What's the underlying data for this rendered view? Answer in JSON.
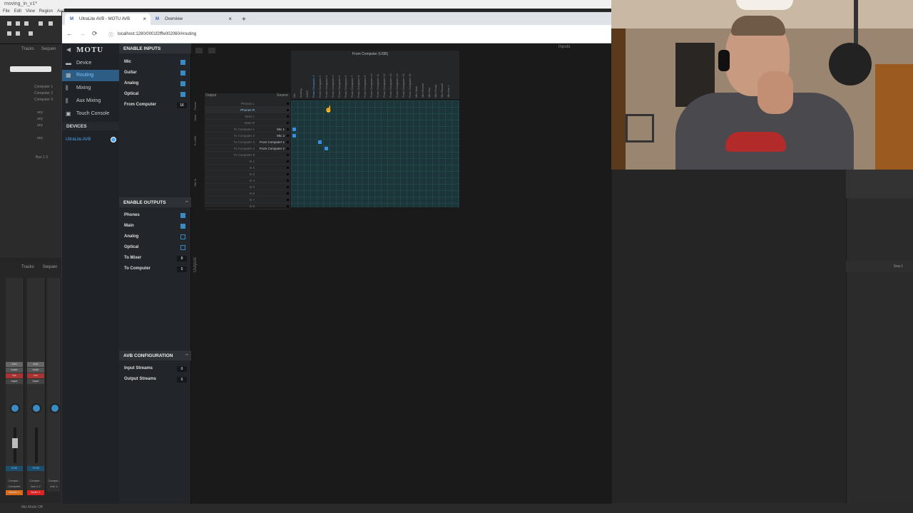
{
  "daw": {
    "title": "moving_in_v1*",
    "menu": [
      "File",
      "Edit",
      "View",
      "Region",
      "Aud"
    ],
    "tabs_top": [
      "Tracks",
      "Sequen"
    ],
    "tabs_bottom": [
      "Tracks",
      "Sequen"
    ],
    "track_list": [
      "Computer 1",
      "Computer 2",
      "Computer 3",
      "any",
      "any",
      "any",
      "any",
      "Bus 1-2"
    ],
    "strip_buttons": [
      "solo",
      "mute",
      "rec",
      "Input",
      "Auto"
    ],
    "strip_values": [
      "0.00",
      "+0.00"
    ],
    "strip_names": [
      "Comput...",
      "Comput...",
      "Comput..."
    ],
    "strip_bus": [
      "Computer",
      "bus 1-2",
      "bus 1-"
    ],
    "strip_bottom": [
      "Master 1",
      "Audio 1"
    ],
    "right_panel_label": "Seq-1",
    "status": "Mix Mode Off"
  },
  "browser": {
    "tabs": [
      {
        "label": "UltraLite AVB - MOTU AVB",
        "favicon": "M",
        "active": true
      },
      {
        "label": "Overview",
        "favicon": "M",
        "active": false
      }
    ],
    "new_tab": "+",
    "url": "localhost:1280/0001f2fffe002060/#routing",
    "nav": {
      "back": "←",
      "forward": "→",
      "reload": "⟳",
      "info": "ⓘ"
    }
  },
  "motu": {
    "logo": "MOTU",
    "back": "◀",
    "nav": [
      {
        "label": "Device",
        "icon": "device-icon",
        "active": false
      },
      {
        "label": "Routing",
        "icon": "routing-icon",
        "active": true
      },
      {
        "label": "Mixing",
        "icon": "mixing-icon",
        "active": false
      },
      {
        "label": "Aux Mixing",
        "icon": "aux-mixing-icon",
        "active": false
      },
      {
        "label": "Touch Console",
        "icon": "touch-console-icon",
        "active": false
      }
    ],
    "devices_header": "DEVICES",
    "device_name": "UltraLite AVB",
    "enable_inputs": {
      "header": "ENABLE INPUTS",
      "rows": [
        {
          "label": "Mic",
          "checked": true
        },
        {
          "label": "Guitar",
          "checked": true
        },
        {
          "label": "Analog",
          "checked": true
        },
        {
          "label": "Optical",
          "checked": true
        },
        {
          "label": "From Computer",
          "value": "16"
        }
      ]
    },
    "enable_outputs": {
      "header": "ENABLE OUTPUTS",
      "rows": [
        {
          "label": "Phones",
          "checked": true
        },
        {
          "label": "Main",
          "checked": true
        },
        {
          "label": "Analog",
          "checked": false
        },
        {
          "label": "Optical",
          "checked": false
        },
        {
          "label": "To Mixer",
          "value": "8"
        },
        {
          "label": "To Computer",
          "value": "5"
        }
      ]
    },
    "avb_config": {
      "header": "AVB CONFIGURATION",
      "rows": [
        {
          "label": "Input Streams",
          "value": "0"
        },
        {
          "label": "Output Streams",
          "value": "0"
        }
      ]
    },
    "routing": {
      "inputs_label": "Inputs",
      "outputs_label": "Outputs",
      "output_header": "Output",
      "source_header": "Source",
      "column_group_title": "From Computer (USB)",
      "columns": [
        "Mic",
        "Analog",
        "ADAT",
        "From Computer 1",
        "From Computer 2",
        "From Computer 3",
        "From Computer 4",
        "From Computer 5",
        "From Computer 6",
        "From Computer 7",
        "From Computer 8",
        "From Computer 9",
        "From Computer 10",
        "From Computer 11",
        "From Computer 12",
        "From Computer 13",
        "From Computer 14",
        "From Computer 15",
        "From Computer 16",
        "Mix Main",
        "Mix Reverb",
        "Mix Aux",
        "Mix Group",
        "Mix Reverb",
        "Mix Aux 1"
      ],
      "group_labels": [
        "Phone",
        "Main",
        "To USB",
        "Mix In"
      ],
      "outputs": [
        {
          "name": "Phones L",
          "source": ""
        },
        {
          "name": "Phones R",
          "source": ""
        },
        {
          "name": "Main L",
          "source": ""
        },
        {
          "name": "Main R",
          "source": ""
        },
        {
          "name": "To Computer 1",
          "source": "Mic 1"
        },
        {
          "name": "To Computer 2",
          "source": "Mic 2"
        },
        {
          "name": "To Computer 3",
          "source": "From Computer 1"
        },
        {
          "name": "To Computer 4",
          "source": "From Computer 2"
        },
        {
          "name": "To Computer 5",
          "source": ""
        },
        {
          "name": "In 1",
          "source": ""
        },
        {
          "name": "In 2",
          "source": ""
        },
        {
          "name": "In 3",
          "source": ""
        },
        {
          "name": "In 4",
          "source": ""
        },
        {
          "name": "In 5",
          "source": ""
        },
        {
          "name": "In 6",
          "source": ""
        },
        {
          "name": "In 7",
          "source": ""
        },
        {
          "name": "In 8",
          "source": ""
        }
      ],
      "connections": [
        {
          "row": 4,
          "col": 0
        },
        {
          "row": 5,
          "col": 0
        },
        {
          "row": 6,
          "col": 4
        },
        {
          "row": 7,
          "col": 5
        }
      ]
    }
  }
}
